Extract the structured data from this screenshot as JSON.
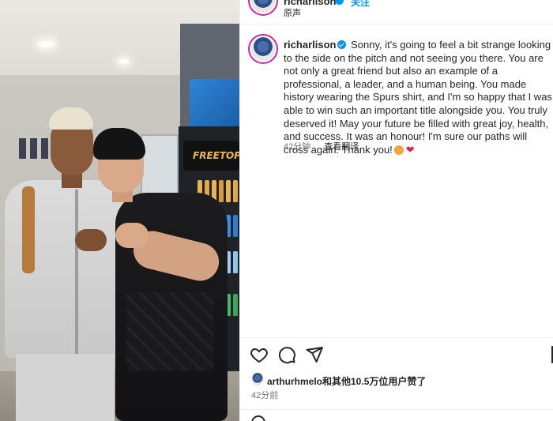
{
  "header": {
    "username": "richarlison",
    "follow_label": "关注",
    "audio_label": "原声"
  },
  "caption": {
    "username": "richarlison",
    "text": "Sonny, it's going to feel a bit strange looking to the side on the pitch and not seeing you there. You are not only a great friend but also an example of a professional, a leader, and a human being. You made history wearing the Spurs shirt, and I'm so happy that I was able to win such an important title alongside you. You truly deserved it! May your future be filled with great joy, health, and success. It was an honour! I'm sure our paths will cross again. Thank you!",
    "time": "42分钟",
    "see_translation": "查看翻译"
  },
  "likes": {
    "text": "arthurhmelo和其他10.5万位用户赞了"
  },
  "post_time": "42分前",
  "photo": {
    "brand_text": "FREETOP"
  },
  "icons": [
    "heart-icon",
    "comment-icon",
    "share-icon",
    "save-icon",
    "verified-badge-icon",
    "emoji-icon"
  ],
  "colors": {
    "accent": "#0095f6",
    "text": "#262626",
    "muted": "#737373",
    "heart": "#e0245e"
  }
}
